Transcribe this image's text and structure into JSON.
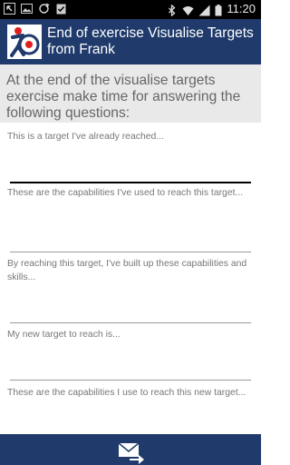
{
  "status_bar": {
    "time": "11:20",
    "left_icons": [
      "back-arrow-icon",
      "image-icon",
      "sync-icon",
      "clipboard-check-icon"
    ],
    "right_icons": [
      "bluetooth-icon",
      "wifi-icon",
      "signal-icon",
      "battery-icon"
    ]
  },
  "header": {
    "title": "End of exercise Visualise Targets from Frank"
  },
  "intro": {
    "text": "At the end of the visualise targets exercise make time for answering the following questions:"
  },
  "questions": [
    {
      "label": "This is a target I've already reached...",
      "value": ""
    },
    {
      "label": "These are the capabilities I've used to reach this target...",
      "value": ""
    },
    {
      "label": "By reaching this target, I've built up these capabilities and skills...",
      "value": ""
    },
    {
      "label": "My new target to reach is...",
      "value": ""
    },
    {
      "label": "These are the capabilities I use to reach this new target...",
      "value": ""
    }
  ],
  "colors": {
    "primary": "#1f3a6b",
    "intro_bg": "#e9e9e9"
  }
}
